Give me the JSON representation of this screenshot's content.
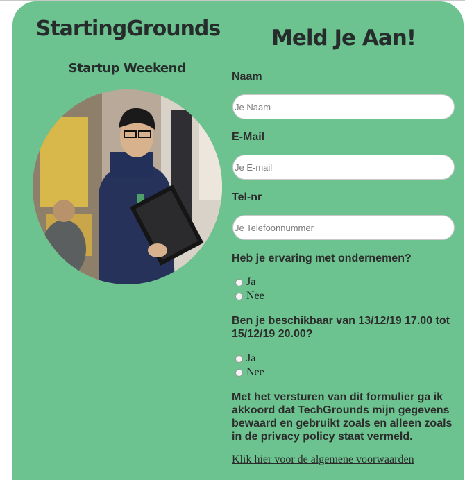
{
  "brand": {
    "title": "StartingGrounds",
    "subtitle": "Startup Weekend"
  },
  "photo": {
    "icon": "person-with-laptop-photo"
  },
  "form": {
    "title": "Meld Je Aan!",
    "fields": {
      "name": {
        "label": "Naam",
        "placeholder": "Je Naam"
      },
      "email": {
        "label": "E-Mail",
        "placeholder": "Je E-mail"
      },
      "phone": {
        "label": "Tel-nr",
        "placeholder": "Je Telefoonnummer"
      }
    },
    "questions": {
      "experience": {
        "text": "Heb je ervaring met ondernemen?",
        "options": [
          "Ja",
          "Nee"
        ]
      },
      "availability": {
        "text": "Ben je beschikbaar van 13/12/19 17.00 tot 15/12/19 20.00?",
        "options": [
          "Ja",
          "Nee"
        ]
      }
    },
    "consent": "Met het versturen van dit formulier ga ik akkoord dat TechGrounds mijn gegevens bewaard en gebruikt zoals en alleen zoals in de privacy policy staat vermeld.",
    "terms_link": "Klik hier voor de algemene voorwaarden"
  },
  "colors": {
    "background": "#6dc390",
    "heading": "#262b2c"
  }
}
